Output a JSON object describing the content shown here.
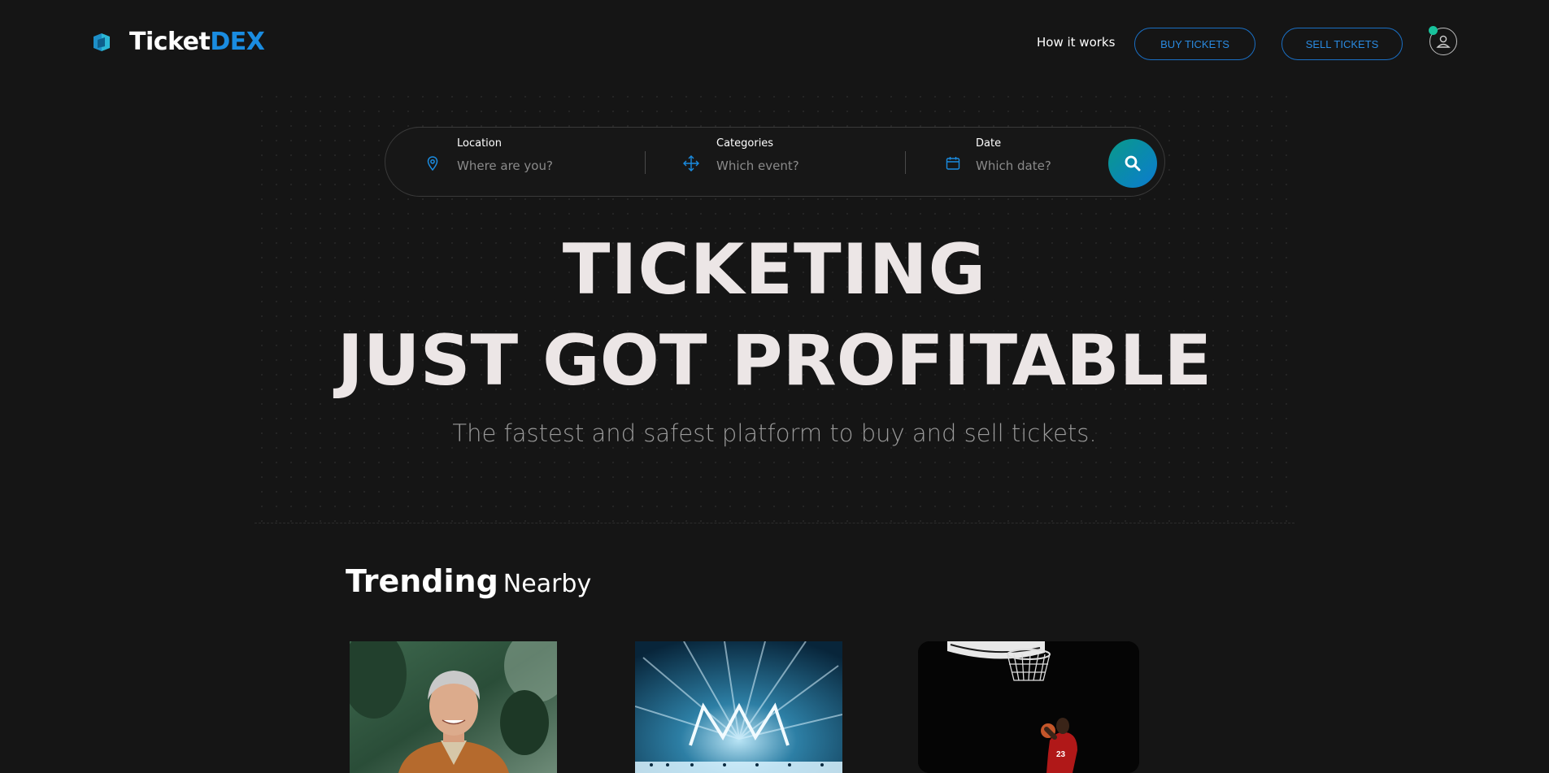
{
  "header": {
    "logo": {
      "part1": "Ticket",
      "part2": "DEX"
    },
    "nav": {
      "how_it_works": "How it works",
      "buy_tickets": "BUY TICKETS",
      "sell_tickets": "SELL TICKETS"
    }
  },
  "search": {
    "location": {
      "label": "Location",
      "placeholder": "Where are you?"
    },
    "categories": {
      "label": "Categories",
      "placeholder": "Which event?"
    },
    "date": {
      "label": "Date",
      "placeholder": "Which date?"
    }
  },
  "hero": {
    "line1": "TICKETING",
    "line2": "JUST GOT PROFITABLE",
    "tagline": "The fastest and safest platform to buy and sell tickets."
  },
  "trending": {
    "title": "Trending",
    "subtitle": "Nearby"
  },
  "colors": {
    "accent": "#1a8ce0",
    "background": "#151515",
    "online": "#18c29c"
  }
}
